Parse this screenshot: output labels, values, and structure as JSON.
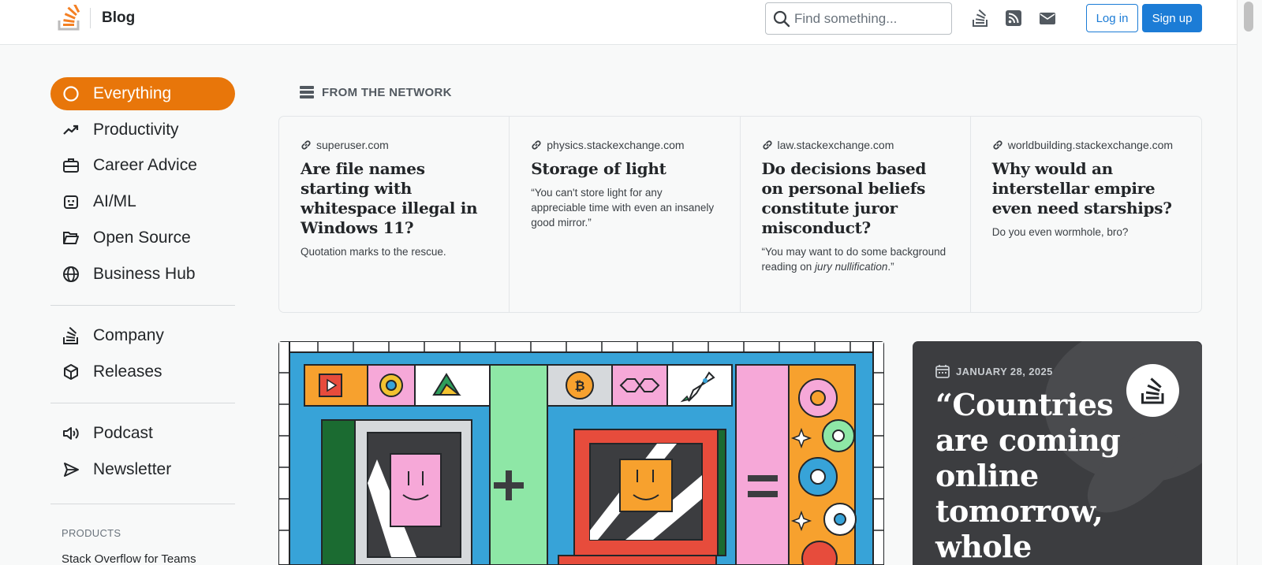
{
  "header": {
    "brand": "Blog",
    "search_placeholder": "Find something...",
    "login_label": "Log in",
    "signup_label": "Sign up",
    "icons": [
      "stackoverflow-icon",
      "rss-icon",
      "mail-icon"
    ]
  },
  "sidebar": {
    "primary": [
      {
        "label": "Everything",
        "icon": "circle-icon",
        "active": true
      },
      {
        "label": "Productivity",
        "icon": "trending-up-icon"
      },
      {
        "label": "Career Advice",
        "icon": "briefcase-icon"
      },
      {
        "label": "AI/ML",
        "icon": "robot-icon"
      },
      {
        "label": "Open Source",
        "icon": "folder-open-icon"
      },
      {
        "label": "Business Hub",
        "icon": "globe-icon"
      }
    ],
    "secondary": [
      {
        "label": "Company",
        "icon": "stackoverflow-icon"
      },
      {
        "label": "Releases",
        "icon": "cube-icon"
      }
    ],
    "tertiary": [
      {
        "label": "Podcast",
        "icon": "speaker-icon"
      },
      {
        "label": "Newsletter",
        "icon": "send-icon"
      }
    ],
    "products_title": "PRODUCTS",
    "products_item": "Stack Overflow for Teams"
  },
  "network": {
    "heading": "FROM THE NETWORK",
    "cards": [
      {
        "site": "superuser.com",
        "title": "Are file names starting with whitespace illegal in Windows 11?",
        "desc": "Quotation marks to the rescue."
      },
      {
        "site": "physics.stackexchange.com",
        "title": "Storage of light",
        "desc": "“You can't store light for any appreciable time with even an insanely good mirror.”"
      },
      {
        "site": "law.stackexchange.com",
        "title": "Do decisions based on personal beliefs constitute juror misconduct?",
        "desc_pre": "“You may want to do some background reading on ",
        "desc_em": "jury nullification",
        "desc_post": ".”"
      },
      {
        "site": "worldbuilding.stackexchange.com",
        "title": "Why would an interstellar empire even need starships?",
        "desc": "Do you even wormhole, bro?"
      }
    ]
  },
  "featured": {
    "date": "JANUARY 28, 2025",
    "title": "“Countries are coming online tomorrow, whole"
  },
  "colors": {
    "accent": "#e8760a",
    "primary_button": "#1c7cd6",
    "text": "#232629",
    "featured_bg": "#3c3d40"
  }
}
